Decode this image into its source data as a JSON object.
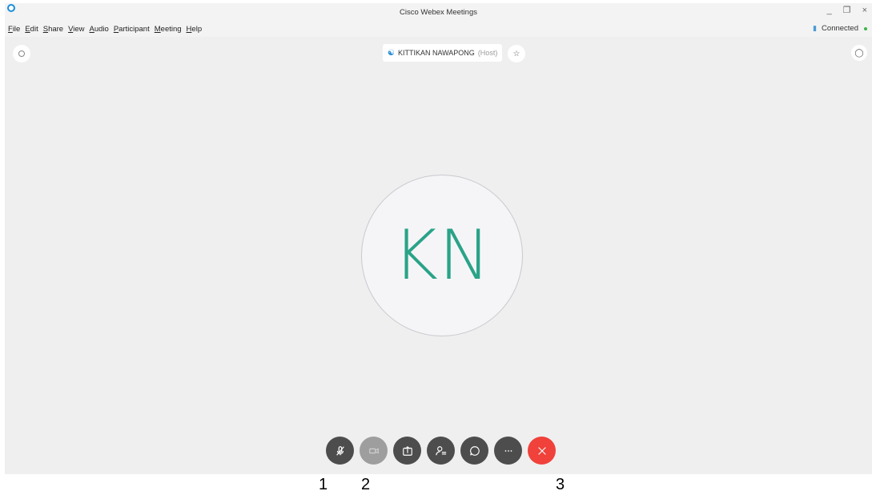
{
  "window": {
    "title": "Cisco Webex Meetings",
    "controls": [
      "_",
      "❐",
      "×"
    ]
  },
  "menu": [
    {
      "label": "File",
      "accel": "F",
      "rest": "ile"
    },
    {
      "label": "Edit",
      "accel": "E",
      "rest": "dit"
    },
    {
      "label": "Share",
      "accel": "S",
      "rest": "hare"
    },
    {
      "label": "View",
      "accel": "V",
      "rest": "iew"
    },
    {
      "label": "Audio",
      "accel": "A",
      "rest": "udio"
    },
    {
      "label": "Participant",
      "accel": "P",
      "rest": "articipant"
    },
    {
      "label": "Meeting",
      "accel": "M",
      "rest": "eeting"
    },
    {
      "label": "Help",
      "accel": "H",
      "rest": "elp"
    }
  ],
  "status": {
    "connection": "Connected",
    "color": "#3ab54a"
  },
  "speaker": {
    "name": "KITTIKAN NAWAPONG",
    "role": "(Host)"
  },
  "avatar": {
    "initials": "KN",
    "color": "#2aa388"
  },
  "controls": [
    {
      "name": "mute",
      "icon": "mic-muted-icon"
    },
    {
      "name": "video",
      "icon": "video-off-icon",
      "disabled": true
    },
    {
      "name": "share",
      "icon": "share-icon"
    },
    {
      "name": "participants",
      "icon": "participants-icon"
    },
    {
      "name": "chat",
      "icon": "chat-icon"
    },
    {
      "name": "more",
      "icon": "more-icon"
    },
    {
      "name": "end",
      "icon": "close-icon",
      "color": "#f0413a"
    }
  ],
  "annotations": [
    "1",
    "2",
    "3"
  ]
}
